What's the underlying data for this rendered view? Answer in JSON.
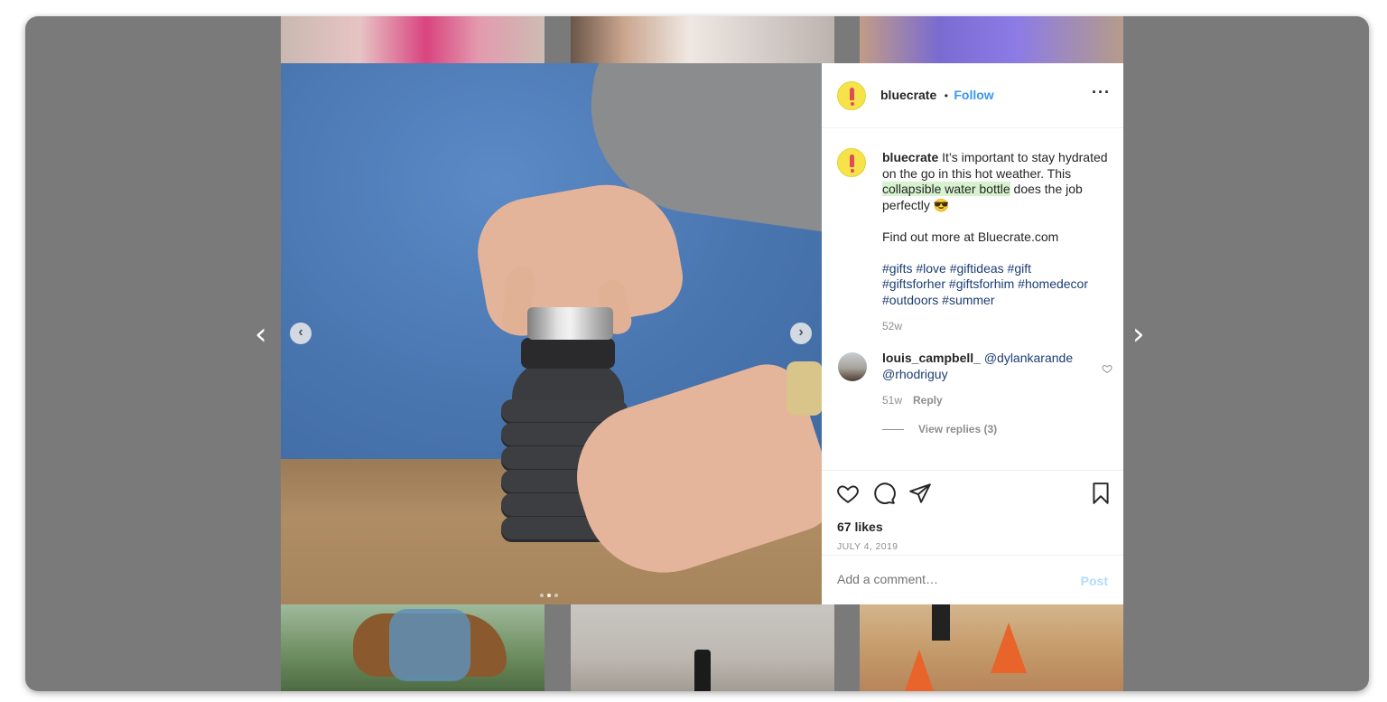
{
  "post": {
    "username": "bluecrate",
    "separator": "•",
    "follow_label": "Follow",
    "more_label": "···",
    "caption": {
      "part1": " It’s important to stay hydrated on the go in this hot weather. This ",
      "highlight": "collapsible water bottle",
      "part2": " does the job perfectly 😎",
      "line2": "Find out more at Bluecrate.com",
      "hashtags_line1": "#gifts #love #giftideas #gift",
      "hashtags_line2": "#giftsforher #giftsforhim #homedecor",
      "hashtags_line3": "#outdoors #summer",
      "age": "52w"
    },
    "comment": {
      "username": "louis_campbell_",
      "text_line1": " @dylankarande",
      "text_line2": "@rhodriguy",
      "age": "51w",
      "reply_label": "Reply",
      "view_replies": "View replies (3)"
    },
    "likes": "67 likes",
    "date": "JULY 4, 2019",
    "comment_placeholder": "Add a comment…",
    "post_label": "Post"
  },
  "nav": {
    "prev_glyph": "‹",
    "next_glyph": "›"
  },
  "carousel": {
    "total": 3,
    "active": 2,
    "prev_glyph": "‹",
    "next_glyph": "›"
  },
  "colors": {
    "accent": "#3897f0",
    "highlight": "#d7f2cf",
    "hashtag": "#1c3d73",
    "brand_yellow": "#f6e34a",
    "brand_red": "#e14a57"
  },
  "icons": [
    "heart-icon",
    "comment-icon",
    "share-icon",
    "bookmark-icon",
    "more-options-icon",
    "chevron-left-icon",
    "chevron-right-icon"
  ]
}
